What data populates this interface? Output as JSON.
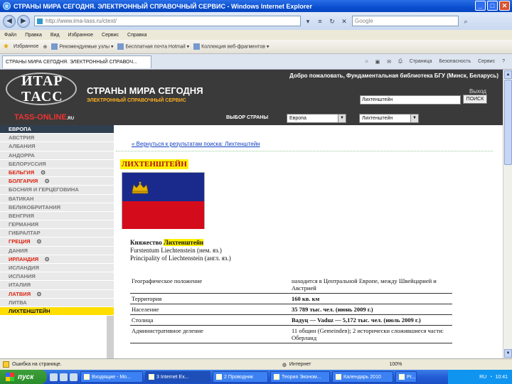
{
  "window": {
    "title": "СТРАНЫ МИРА СЕГОДНЯ. ЭЛЕКТРОННЫЙ СПРАВОЧНЫЙ СЕРВИС - Windows Internet Explorer",
    "min": "_",
    "max": "□",
    "close": "✕"
  },
  "address": {
    "url": "http://www.ima-tass.ru/ctext/",
    "search_placeholder": "Google"
  },
  "menu": [
    "Файл",
    "Правка",
    "Вид",
    "Избранное",
    "Сервис",
    "Справка"
  ],
  "favorites": {
    "label": "Избранное",
    "items": [
      "Рекомендуемые узлы",
      "Бесплатная почта Hotmail",
      "Коллекция веб-фрагментов"
    ]
  },
  "tab": {
    "title": "СТРАНЫ МИРА СЕГОДНЯ. ЭЛЕКТРОННЫЙ СПРАВОЧ...",
    "tools": [
      "Страница",
      "Безопасность",
      "Сервис"
    ]
  },
  "site": {
    "welcome": "Добро пожаловать, Фундаментальная библиотека БГУ (Минск, Беларусь)",
    "logo_line1": "ИТАР",
    "logo_line2": "ТАСС",
    "logo_online": "TASS-ONLINE",
    "logo_online_suffix": ".RU",
    "title": "СТРАНЫ МИРА СЕГОДНЯ",
    "subtitle": "ЭЛЕКТРОННЫЙ СПРАВОЧНЫЙ СЕРВИС",
    "search_value": "Лихтенштейн",
    "search_button": "ПОИСК",
    "login": "Выход",
    "choose_country": "ВЫБОР СТРАНЫ",
    "region_select": "Европа",
    "country_select": "Лихтенштейн"
  },
  "sidebar": [
    {
      "label": "ЕВРОПА",
      "state": "active"
    },
    {
      "label": "АВСТРИЯ",
      "state": ""
    },
    {
      "label": "АЛБАНИЯ",
      "state": ""
    },
    {
      "label": "АНДОРРА",
      "state": ""
    },
    {
      "label": "БЕЛОРУССИЯ",
      "state": ""
    },
    {
      "label": "БЕЛЬГИЯ",
      "state": "red",
      "mark": "⊙"
    },
    {
      "label": "БОЛГАРИЯ",
      "state": "red",
      "mark": "⊙"
    },
    {
      "label": "БОСНИЯ И ГЕРЦЕГОВИНА",
      "state": ""
    },
    {
      "label": "ВАТИКАН",
      "state": ""
    },
    {
      "label": "ВЕЛИКОБРИТАНИЯ",
      "state": ""
    },
    {
      "label": "ВЕНГРИЯ",
      "state": ""
    },
    {
      "label": "ГЕРМАНИЯ",
      "state": ""
    },
    {
      "label": "ГИБРАЛТАР",
      "state": ""
    },
    {
      "label": "ГРЕЦИЯ",
      "state": "red",
      "mark": "⊙"
    },
    {
      "label": "ДАНИЯ",
      "state": ""
    },
    {
      "label": "ИРЛАНДИЯ",
      "state": "red",
      "mark": "⊙"
    },
    {
      "label": "ИСЛАНДИЯ",
      "state": ""
    },
    {
      "label": "ИСПАНИЯ",
      "state": ""
    },
    {
      "label": "ИТАЛИЯ",
      "state": ""
    },
    {
      "label": "ЛАТВИЯ",
      "state": "red",
      "mark": "⊙"
    },
    {
      "label": "ЛИТВА",
      "state": ""
    },
    {
      "label": "ЛИХТЕНШТЕЙН",
      "state": "highlight"
    }
  ],
  "main": {
    "back_link": "« Вернуться к результатам поиска: Лихтенштейн",
    "country_title": "ЛИХТЕНШТЕЙН",
    "name_prefix": "Княжество ",
    "name_highlight": "Лихтенштейн",
    "name_de": "Furstentum Liechtenstein (нем. яз.)",
    "name_en": "Principality of Liechtenstein (англ. яз.)",
    "table": [
      [
        "Географическое положение",
        "находится в Центральной Европе, между Швейцарией и Австрией"
      ],
      [
        "Территория",
        "160 кв. км"
      ],
      [
        "Население",
        "35 789 тыс. чел. (июнь 2009 г.)"
      ],
      [
        "Столица",
        "Вадуц — Vaduz — 5,172 тыс. чел. (июль 2009 г.)"
      ],
      [
        "Административное деление",
        "11 общин (Gemeinden); 2 исторически сложившиеся части: Оберланд"
      ]
    ]
  },
  "status": {
    "text": "Ошибка на странице.",
    "zone": "Интернет",
    "zoom": "100%"
  },
  "taskbar": {
    "start": "пуск",
    "tasks": [
      "Входящие - Mo...",
      "3 Internet Ex...",
      "2 Проводник",
      "Теория Эконом...",
      "Календарь 2010",
      "Pr..."
    ],
    "clock": "10:41",
    "lang": "RU"
  },
  "colors": {
    "accent": "#ffde00",
    "header_bg": "#3a3a3a",
    "flag_blue": "#1a2a8c",
    "flag_red": "#d40b1a",
    "link": "#1040c0"
  }
}
